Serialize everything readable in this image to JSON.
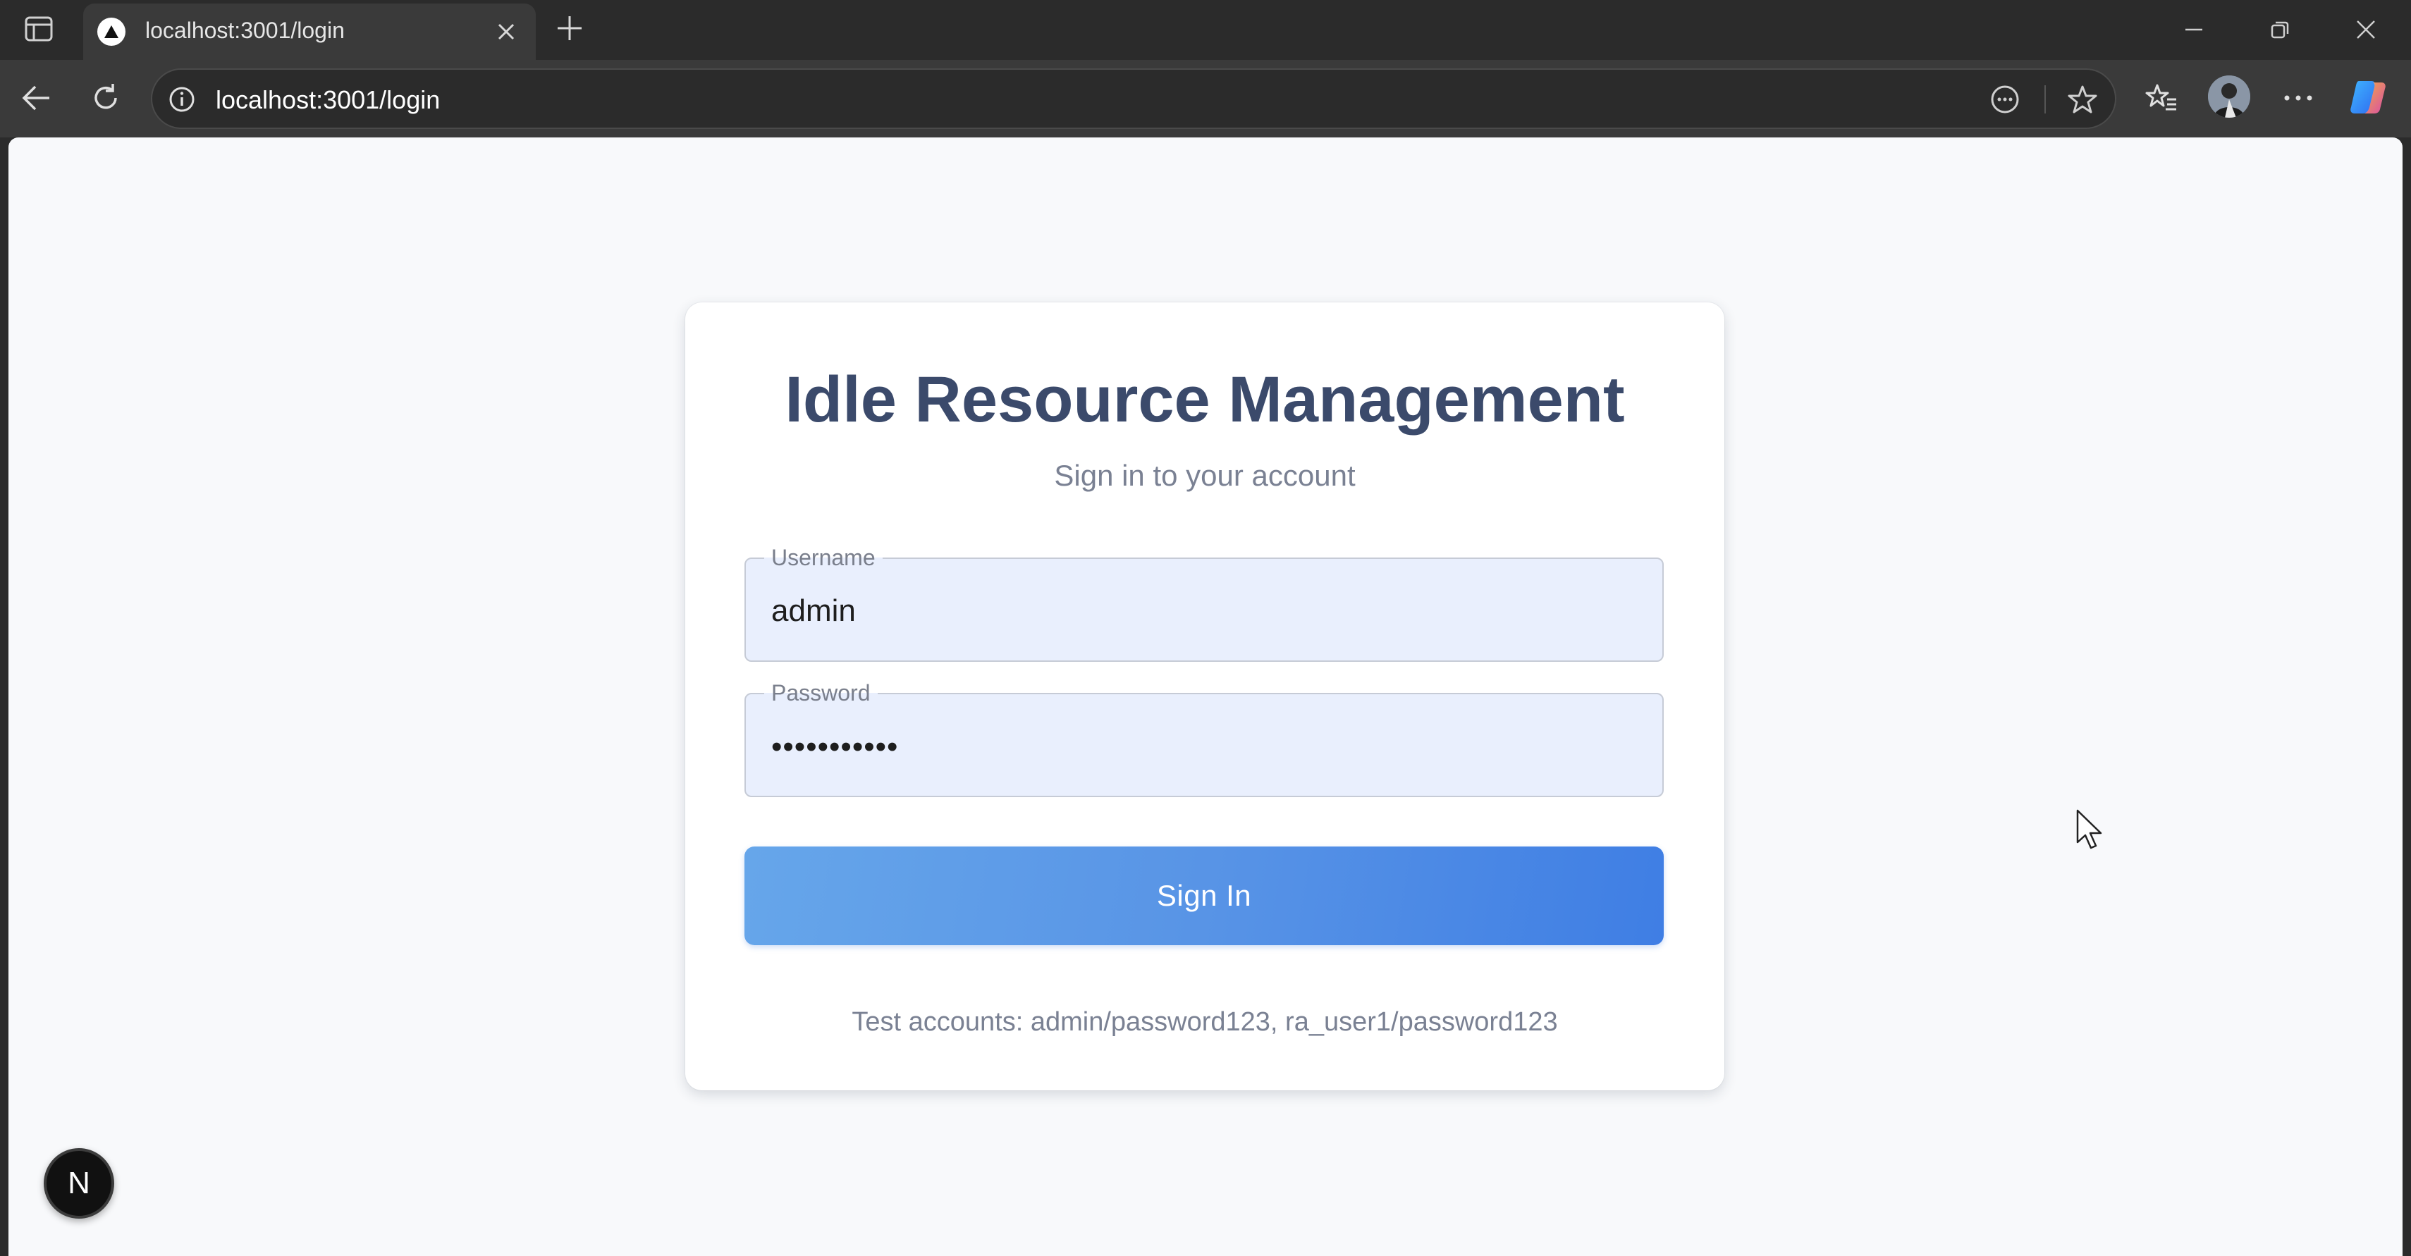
{
  "browser": {
    "tab": {
      "title": "localhost:3001/login",
      "favicon": "nextjs-triangle-icon"
    },
    "address_bar": {
      "url": "localhost:3001/login"
    },
    "icons": [
      "sidebar-icon",
      "close-icon",
      "plus-icon",
      "minimize-icon",
      "restore-icon",
      "back-arrow-icon",
      "refresh-icon",
      "info-icon",
      "reader-icon",
      "star-icon",
      "favorites-icon",
      "more-icon",
      "copilot-icon"
    ]
  },
  "page": {
    "title": "Idle Resource Management",
    "subtitle": "Sign in to your account",
    "username": {
      "label": "Username",
      "value": "admin"
    },
    "password": {
      "label": "Password",
      "masked_value": "•••••••••••"
    },
    "submit_label": "Sign In",
    "footnote": "Test accounts: admin/password123, ra_user1/password123",
    "dev_badge": "N"
  },
  "colors": {
    "title": "#3b4a6b",
    "input_background": "#e9effd",
    "button_gradient_start": "#66a6ea",
    "button_gradient_end": "#3f7ee4",
    "page_background": "#f8f9fb",
    "browser_chrome": "#2b2b2b"
  }
}
